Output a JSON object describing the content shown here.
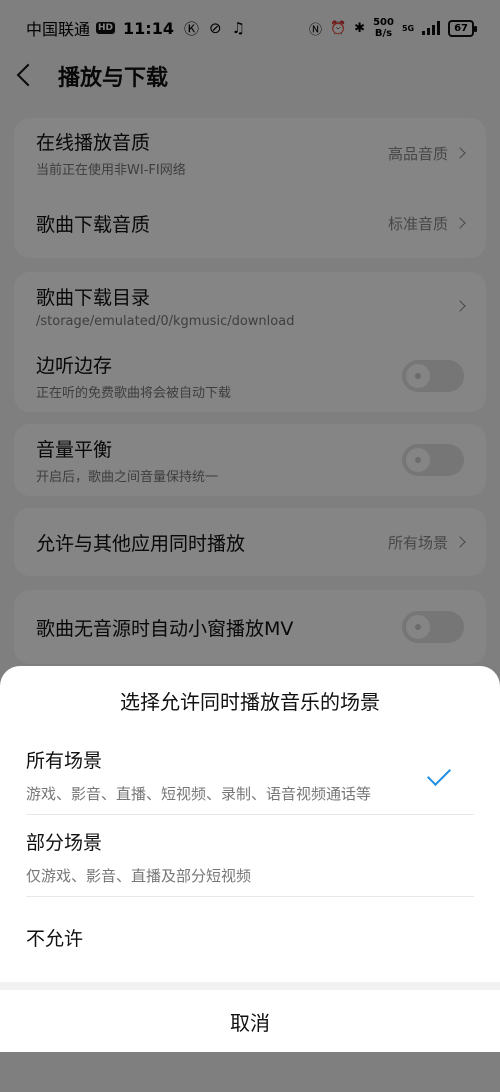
{
  "status_bar": {
    "carrier": "中国联通",
    "hd_badge": "HD",
    "time": "11:14",
    "net_speed_value": "500",
    "net_speed_unit": "B/s",
    "signal_label": "5G",
    "battery": "67"
  },
  "header": {
    "title": "播放与下载"
  },
  "settings": {
    "online_quality": {
      "title": "在线播放音质",
      "subtitle": "当前正在使用非WI-FI网络",
      "value": "高品音质"
    },
    "download_quality": {
      "title": "歌曲下载音质",
      "value": "标准音质"
    },
    "download_dir": {
      "title": "歌曲下载目录",
      "subtitle": "/storage/emulated/0/kgmusic/download"
    },
    "listen_save": {
      "title": "边听边存",
      "subtitle": "正在听的免费歌曲将会被自动下载",
      "enabled": false
    },
    "volume_balance": {
      "title": "音量平衡",
      "subtitle": "开启后，歌曲之间音量保持统一",
      "enabled": false
    },
    "allow_simultaneous": {
      "title": "允许与其他应用同时播放",
      "value": "所有场景"
    },
    "auto_mv": {
      "title": "歌曲无音源时自动小窗播放MV",
      "enabled": false
    }
  },
  "sheet": {
    "title": "选择允许同时播放音乐的场景",
    "options": [
      {
        "title": "所有场景",
        "subtitle": "游戏、影音、直播、短视频、录制、语音视频通话等",
        "selected": true
      },
      {
        "title": "部分场景",
        "subtitle": "仅游戏、影音、直播及部分短视频",
        "selected": false
      },
      {
        "title": "不允许",
        "selected": false
      }
    ],
    "cancel": "取消",
    "accent_color": "#1f8fe5"
  }
}
